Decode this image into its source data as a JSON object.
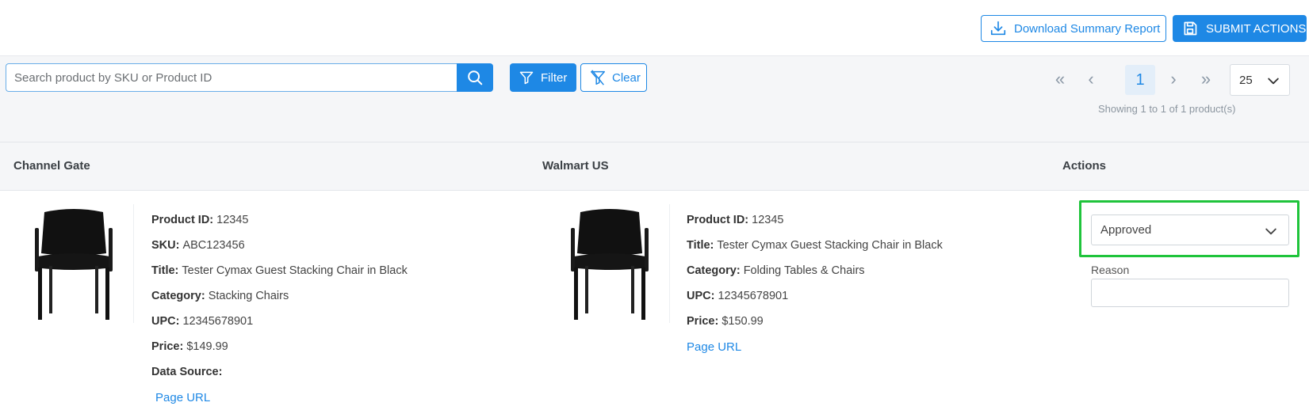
{
  "header": {
    "download_label": "Download Summary Report",
    "submit_label": "SUBMIT ACTIONS"
  },
  "toolbar": {
    "search_placeholder": "Search product by SKU or Product ID",
    "filter_label": "Filter",
    "clear_label": "Clear"
  },
  "pagination": {
    "first": "«",
    "prev": "‹",
    "current_page": "1",
    "next": "›",
    "last": "»",
    "page_size": "25",
    "showing_text": "Showing 1 to 1 of 1 product(s)"
  },
  "table": {
    "columns": [
      "Channel Gate",
      "Walmart US",
      "Actions"
    ]
  },
  "row": {
    "channel_gate": {
      "product_id_label": "Product ID:",
      "product_id": "12345",
      "sku_label": "SKU:",
      "sku": "ABC123456",
      "title_label": "Title:",
      "title": "Tester Cymax Guest Stacking Chair in Black",
      "category_label": "Category:",
      "category": "Stacking Chairs",
      "upc_label": "UPC:",
      "upc": "12345678901",
      "price_label": "Price:",
      "price": "$149.99",
      "data_source_label": "Data Source:",
      "page_url_label": "Page URL"
    },
    "walmart": {
      "product_id_label": "Product ID:",
      "product_id": "12345",
      "title_label": "Title:",
      "title": "Tester Cymax Guest Stacking Chair in Black",
      "category_label": "Category:",
      "category": "Folding Tables & Chairs",
      "upc_label": "UPC:",
      "upc": "12345678901",
      "price_label": "Price:",
      "price": "$150.99",
      "page_url_label": "Page URL"
    },
    "actions": {
      "status_value": "Approved",
      "reason_label": "Reason",
      "reason_value": ""
    }
  },
  "colors": {
    "primary": "#1e88e5",
    "highlight": "#1fc43b"
  },
  "icons": [
    "download-icon",
    "save-icon",
    "search-icon",
    "filter-icon",
    "filter-clear-icon",
    "chevron-down-icon",
    "chair-image"
  ]
}
